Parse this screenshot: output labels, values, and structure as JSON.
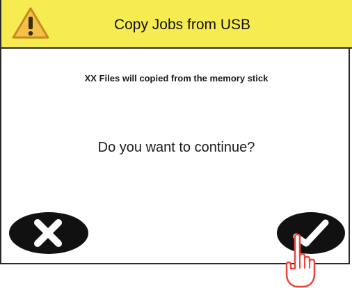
{
  "dialog": {
    "title": "Copy Jobs from USB",
    "title_icon": "warning-icon",
    "message": "XX Files will copied from the memory stick",
    "question": "Do you want to continue?",
    "cancel_icon": "x-icon",
    "confirm_icon": "checkmark-icon",
    "pointer_icon": "hand-pointer-icon"
  },
  "colors": {
    "titlebar": "#f6ec52",
    "warning_fill": "#f4c04a",
    "button_fill": "#111111",
    "hand_outline": "#e8453c"
  }
}
